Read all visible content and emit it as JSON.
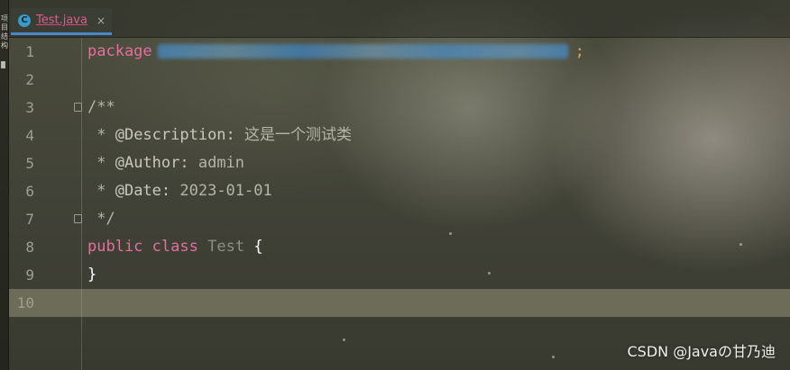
{
  "tab": {
    "icon_letter": "C",
    "label": "Test.java",
    "close": "×"
  },
  "left_strip": {
    "text": "项目结构"
  },
  "line_numbers": [
    "1",
    "2",
    "3",
    "4",
    "5",
    "6",
    "7",
    "8",
    "9",
    "10"
  ],
  "code": {
    "line1_keyword": "package",
    "line1_semicolon": ";",
    "line3": "/**",
    "line4_prefix": " * ",
    "line4_tag": "@Description:",
    "line4_text": " 这是一个测试类",
    "line5_prefix": " * ",
    "line5_tag": "@Author:",
    "line5_text": " admin",
    "line6_prefix": " * ",
    "line6_tag": "@Date:",
    "line6_text": " 2023-01-01",
    "line7": " */",
    "line8_kw1": "public",
    "line8_kw2": "class",
    "line8_name": "Test",
    "line8_brace": "{",
    "line9_brace": "}"
  },
  "watermark": "CSDN @Javaの甘乃迪",
  "colors": {
    "keyword": "#e46ea0",
    "tab_underline": "#4a88c7",
    "current_line": "#969478"
  }
}
